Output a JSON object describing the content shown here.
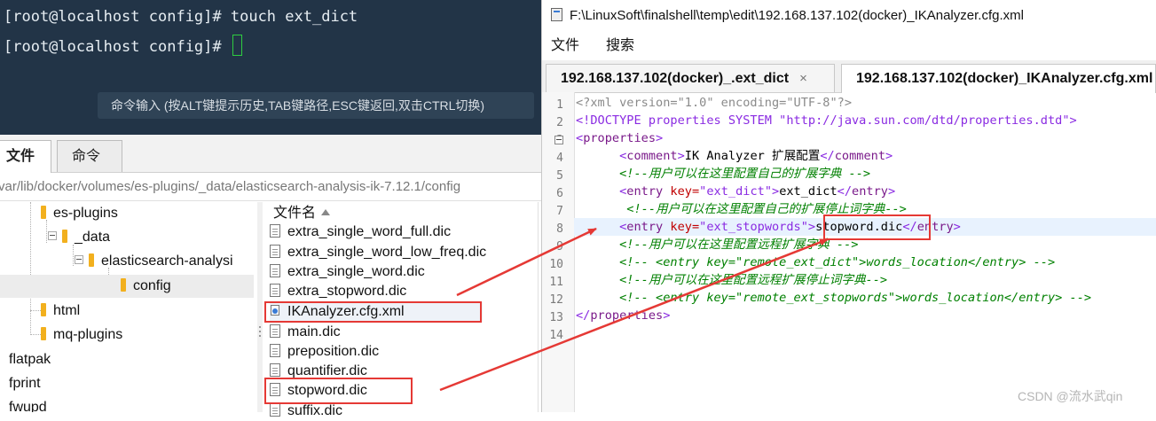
{
  "terminal": {
    "lines": [
      "[root@localhost config]# touch ext_dict",
      "[root@localhost config]# "
    ],
    "cmd_hint": "命令输入 (按ALT键提示历史,TAB键路径,ESC键返回,双击CTRL切换)"
  },
  "file_manager": {
    "tabs": [
      "文件",
      "命令"
    ],
    "path": "var/lib/docker/volumes/es-plugins/_data/elasticsearch-analysis-ik-7.12.1/config",
    "tree": [
      {
        "label": "es-plugins"
      },
      {
        "label": "_data"
      },
      {
        "label": "elasticsearch-analysi"
      },
      {
        "label": "config"
      },
      {
        "label": "html"
      },
      {
        "label": "mq-plugins"
      },
      {
        "label": "flatpak"
      },
      {
        "label": "fprint"
      },
      {
        "label": "fwupd"
      }
    ],
    "files_header": "文件名",
    "files": [
      "extra_single_word_full.dic",
      "extra_single_word_low_freq.dic",
      "extra_single_word.dic",
      "extra_stopword.dic",
      "IKAnalyzer.cfg.xml",
      "main.dic",
      "preposition.dic",
      "quantifier.dic",
      "stopword.dic",
      "suffix.dic"
    ]
  },
  "editor": {
    "title": "F:\\LinuxSoft\\finalshell\\temp\\edit\\192.168.137.102(docker)_IKAnalyzer.cfg.xml",
    "menu": [
      "文件",
      "搜索"
    ],
    "tabs": [
      {
        "label": "192.168.137.102(docker)_.ext_dict",
        "close": "×"
      },
      {
        "label": "192.168.137.102(docker)_IKAnalyzer.cfg.xml"
      }
    ],
    "line_numbers": [
      "1",
      "2",
      "3",
      "4",
      "5",
      "6",
      "7",
      "8",
      "9",
      "10",
      "11",
      "12",
      "13",
      "14"
    ],
    "code": {
      "l1": "<?xml version=\"1.0\" encoding=\"UTF-8\"?>",
      "l2": "<!DOCTYPE properties SYSTEM \"http://java.sun.com/dtd/properties.dtd\">",
      "lt": "<",
      "gt": ">",
      "lt_slash": "</",
      "properties": "properties",
      "comment": "comment",
      "entry": "entry",
      "key_attr": "key=",
      "l4_text": "IK Analyzer 扩展配置",
      "l5_comment": "<!--用户可以在这里配置自己的扩展字典 -->",
      "l6_key": "\"ext_dict\"",
      "l6_text": "ext_dict",
      "l7_comment": "<!--用户可以在这里配置自己的扩展停止词字典-->",
      "l8_key": "\"ext_stopwords\"",
      "l8_text": "stopword.dic",
      "l9_comment": "<!--用户可以在这里配置远程扩展字典 -->",
      "l10_comment": "<!-- <entry key=\"remote_ext_dict\">words_location</entry> -->",
      "l11_comment": "<!--用户可以在这里配置远程扩展停止词字典-->",
      "l12_comment": "<!-- <entry key=\"remote_ext_stopwords\">words_location</entry> -->"
    }
  },
  "watermark": "CSDN @流水武qin",
  "colors": {
    "annotation_red": "#e53935",
    "terminal_bg": "#223447"
  }
}
